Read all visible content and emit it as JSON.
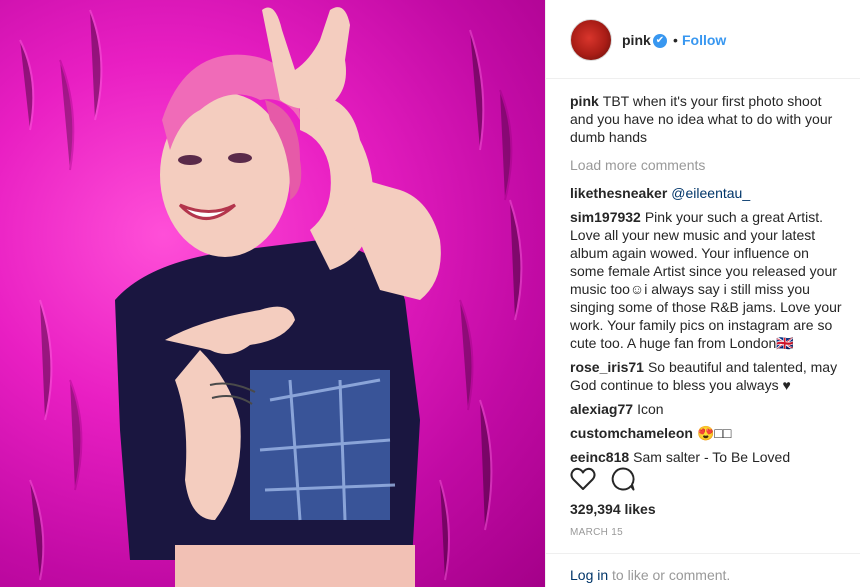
{
  "post": {
    "username": "pink",
    "verified_mark": "✔",
    "separator": "•",
    "follow_label": "Follow",
    "caption": "TBT when it's your first photo shoot and you have no idea what to do with your dumb hands",
    "load_more": "Load more comments",
    "comments": [
      {
        "user": "likethesneaker",
        "text": "",
        "mention": "@eileentau_"
      },
      {
        "user": "sim197932",
        "text": "Pink your such a great Artist. Love all your new music and your latest album again wowed. Your influence on some female Artist since you released your music too☺i always say i still miss you singing some of those R&B jams. Love your work. Your family pics on instagram are so cute too. A huge fan from London🇬🇧",
        "mention": ""
      },
      {
        "user": "rose_iris71",
        "text": "So beautiful and talented, may God continue to bless you always ♥",
        "mention": ""
      },
      {
        "user": "alexiag77",
        "text": "Icon",
        "mention": ""
      },
      {
        "user": "customchameleon",
        "text": "😍□□",
        "mention": ""
      },
      {
        "user": "eeinc818",
        "text": "Sam salter - To Be Loved",
        "mention": ""
      }
    ],
    "likes": "329,394 likes",
    "date": "MARCH 15",
    "footer_login": "Log in",
    "footer_rest": " to like or comment."
  },
  "icons": {
    "like": "heart-icon",
    "comment": "comment-icon",
    "verified": "verified-badge-icon"
  },
  "colors": {
    "accent": "#3897f0",
    "background_photo": "#e91fc3",
    "text": "#262626",
    "muted": "#999999",
    "link": "#003569"
  }
}
